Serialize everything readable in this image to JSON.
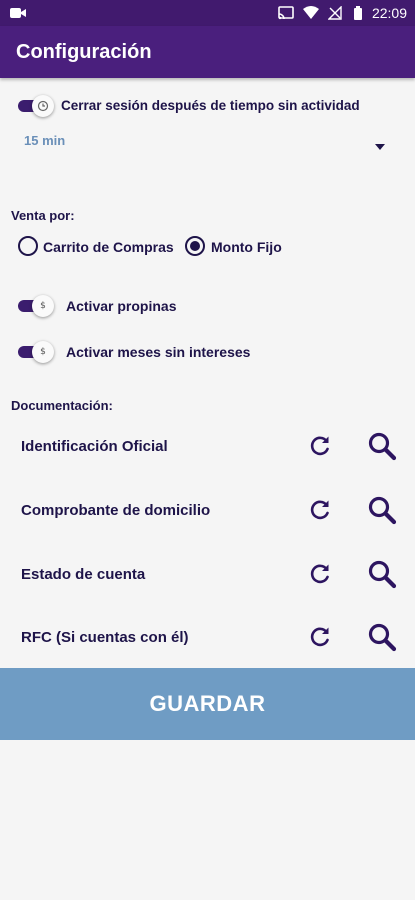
{
  "status_bar": {
    "time": "22:09",
    "icons": [
      "video-camera-icon",
      "cast-icon",
      "wifi-icon",
      "no-signal-icon",
      "battery-icon"
    ]
  },
  "app_bar": {
    "title": "Configuración"
  },
  "session": {
    "toggle_label": "Cerrar sesión después de tiempo sin actividad",
    "timeout_value": "15 min",
    "enabled": true
  },
  "sale": {
    "section_label": "Venta por:",
    "options": [
      "Carrito de Compras",
      "Monto Fijo"
    ],
    "selected": "Monto Fijo"
  },
  "tips": {
    "label": "Activar propinas",
    "enabled": true
  },
  "msi": {
    "label": "Activar meses sin intereses",
    "enabled": true
  },
  "documents": {
    "section_label": "Documentación:",
    "items": [
      {
        "label": "Identificación Oficial"
      },
      {
        "label": "Comprobante de domicilio"
      },
      {
        "label": "Estado de cuenta"
      },
      {
        "label": "RFC (Si cuentas con él)"
      }
    ]
  },
  "save_button": {
    "label": "GUARDAR"
  },
  "colors": {
    "primary": "#4a1f7d",
    "dark_text": "#1e1449",
    "accent_blue": "#6f9cc4"
  }
}
